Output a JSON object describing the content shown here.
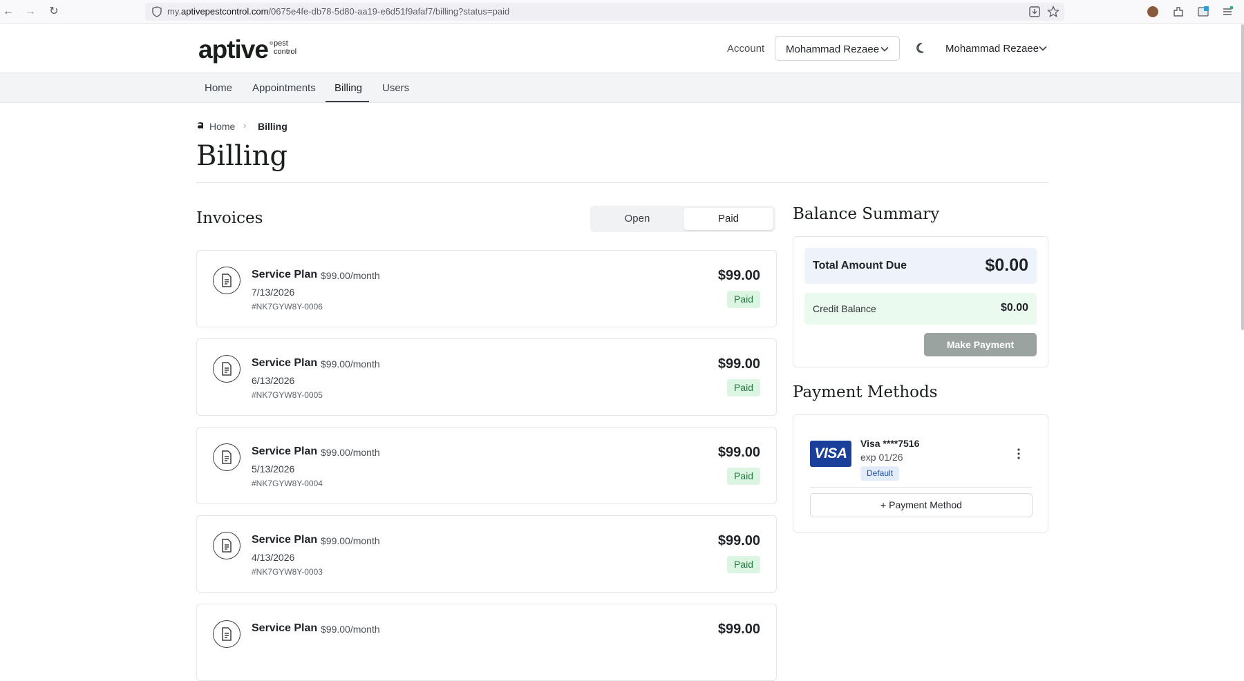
{
  "browser": {
    "url_prefix": "my.",
    "url_domain": "aptivepestcontrol.com",
    "url_path": "/0675e4fe-db78-5d80-aa19-e6d51f9afaf7/billing?status=paid"
  },
  "header": {
    "logo_text": "aptive",
    "logo_reg": "®",
    "logo_sub_1": "pest",
    "logo_sub_2": "control",
    "account_label": "Account",
    "account_value": "Mohammad Rezaee",
    "user_name": "Mohammad Rezaee"
  },
  "tabs": [
    {
      "label": "Home"
    },
    {
      "label": "Appointments"
    },
    {
      "label": "Billing",
      "active": true
    },
    {
      "label": "Users"
    }
  ],
  "breadcrumb": {
    "home": "Home",
    "separator": "›",
    "current": "Billing"
  },
  "page_title": "Billing",
  "invoices": {
    "title": "Invoices",
    "filter_options": [
      "Open",
      "Paid"
    ],
    "filter_selected": "Paid",
    "items": [
      {
        "title": "Service Plan",
        "rate": "$99.00/month",
        "date": "7/13/2026",
        "number": "#NK7GYW8Y-0006",
        "amount": "$99.00",
        "status": "Paid"
      },
      {
        "title": "Service Plan",
        "rate": "$99.00/month",
        "date": "6/13/2026",
        "number": "#NK7GYW8Y-0005",
        "amount": "$99.00",
        "status": "Paid"
      },
      {
        "title": "Service Plan",
        "rate": "$99.00/month",
        "date": "5/13/2026",
        "number": "#NK7GYW8Y-0004",
        "amount": "$99.00",
        "status": "Paid"
      },
      {
        "title": "Service Plan",
        "rate": "$99.00/month",
        "date": "4/13/2026",
        "number": "#NK7GYW8Y-0003",
        "amount": "$99.00",
        "status": "Paid"
      },
      {
        "title": "Service Plan",
        "rate": "$99.00/month",
        "date": "",
        "number": "",
        "amount": "$99.00",
        "status": ""
      }
    ]
  },
  "balance_summary": {
    "title": "Balance Summary",
    "total_label": "Total Amount Due",
    "total_value": "$0.00",
    "credit_label": "Credit Balance",
    "credit_value": "$0.00",
    "pay_button": "Make Payment"
  },
  "payment_methods": {
    "title": "Payment Methods",
    "card_brand_logo": "VISA",
    "card_name": "Visa ****7516",
    "card_exp": "exp 01/26",
    "card_badge": "Default",
    "add_button": "+ Payment Method"
  },
  "icons": [
    "back-icon",
    "forward-icon",
    "reload-icon",
    "shield-icon",
    "download-icon",
    "star-icon",
    "avatar-icon",
    "extensions-icon",
    "menu-icon",
    "chevron-down-icon",
    "moon-icon",
    "document-icon",
    "kebab-icon"
  ],
  "colors": {
    "paid_badge_bg": "#dcf5e3",
    "paid_badge_text": "#1e7a3a",
    "total_row_bg": "#eef3fb",
    "credit_row_bg": "#eafaee",
    "pay_button_bg": "#9aa3a0",
    "visa_blue": "#1a3f9b"
  }
}
